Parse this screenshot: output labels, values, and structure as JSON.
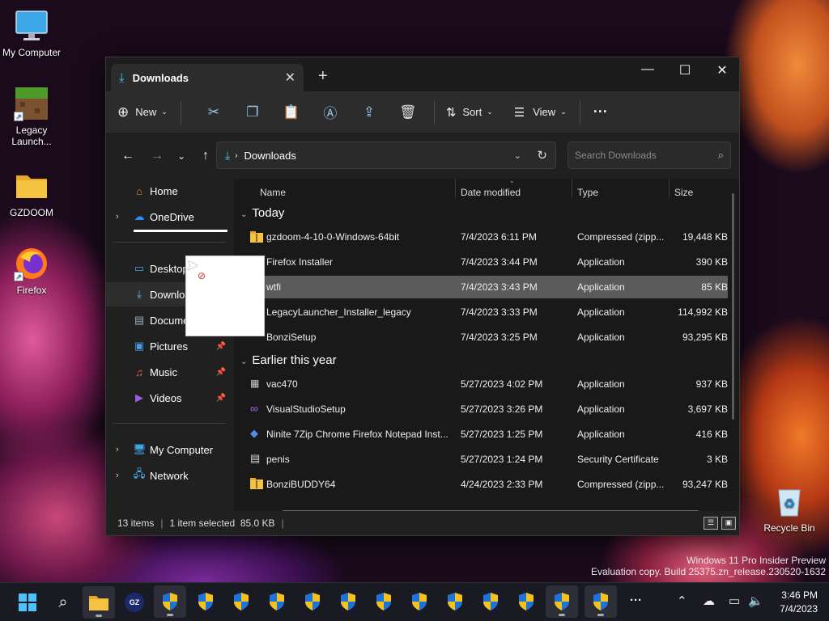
{
  "desktop": {
    "icons": [
      {
        "label": "My Computer",
        "icon": "monitor-icon"
      },
      {
        "label": "Legacy Launch...",
        "icon": "minecraft-icon"
      },
      {
        "label": "GZDOOM",
        "icon": "folder-icon"
      },
      {
        "label": "Firefox",
        "icon": "firefox-icon"
      },
      {
        "label": "Recycle Bin",
        "icon": "recycle-bin-icon"
      }
    ]
  },
  "window": {
    "tab_title": "Downloads",
    "toolbar": {
      "new_label": "New",
      "sort_label": "Sort",
      "view_label": "View"
    },
    "address": {
      "path": "Downloads",
      "search_placeholder": "Search Downloads"
    },
    "sidebar": {
      "items": [
        {
          "label": "Home",
          "icon": "home-icon"
        },
        {
          "label": "OneDrive",
          "icon": "cloud-icon"
        },
        {
          "label": "Desktop",
          "icon": "desktop-icon"
        },
        {
          "label": "Downloads",
          "icon": "download-icon"
        },
        {
          "label": "Documents",
          "icon": "document-icon"
        },
        {
          "label": "Pictures",
          "icon": "pictures-icon"
        },
        {
          "label": "Music",
          "icon": "music-icon"
        },
        {
          "label": "Videos",
          "icon": "videos-icon"
        },
        {
          "label": "My Computer",
          "icon": "computer-icon"
        },
        {
          "label": "Network",
          "icon": "network-icon"
        }
      ]
    },
    "columns": {
      "name": "Name",
      "date": "Date modified",
      "type": "Type",
      "size": "Size"
    },
    "groups": {
      "today": "Today",
      "earlier": "Earlier this year"
    },
    "files": [
      {
        "name": "gzdoom-4-10-0-Windows-64bit",
        "date": "7/4/2023 6:11 PM",
        "type": "Compressed (zipp...",
        "size": "19,448 KB",
        "icon": "zip-folder-icon"
      },
      {
        "name": "Firefox Installer",
        "date": "7/4/2023 3:44 PM",
        "type": "Application",
        "size": "390 KB",
        "icon": "app-icon"
      },
      {
        "name": "wtfi",
        "date": "7/4/2023 3:43 PM",
        "type": "Application",
        "size": "85 KB",
        "icon": "app-icon"
      },
      {
        "name": "LegacyLauncher_Installer_legacy",
        "date": "7/4/2023 3:33 PM",
        "type": "Application",
        "size": "114,992 KB",
        "icon": "app-icon"
      },
      {
        "name": "BonziSetup",
        "date": "7/4/2023 3:25 PM",
        "type": "Application",
        "size": "93,295 KB",
        "icon": "app-icon"
      },
      {
        "name": "vac470",
        "date": "5/27/2023 4:02 PM",
        "type": "Application",
        "size": "937 KB",
        "icon": "installer-icon"
      },
      {
        "name": "VisualStudioSetup",
        "date": "5/27/2023 3:26 PM",
        "type": "Application",
        "size": "3,697 KB",
        "icon": "visual-studio-icon"
      },
      {
        "name": "Ninite 7Zip Chrome Firefox Notepad Inst...",
        "date": "5/27/2023 1:25 PM",
        "type": "Application",
        "size": "416 KB",
        "icon": "ninite-icon"
      },
      {
        "name": "penis",
        "date": "5/27/2023 1:24 PM",
        "type": "Security Certificate",
        "size": "3 KB",
        "icon": "certificate-icon"
      },
      {
        "name": "BonziBUDDY64",
        "date": "4/24/2023 2:33 PM",
        "type": "Compressed (zipp...",
        "size": "93,247 KB",
        "icon": "zip-folder-icon"
      }
    ],
    "status": {
      "count": "13 items",
      "selected": "1 item selected  85.0 KB"
    }
  },
  "watermark": {
    "line1": "Windows 11 Pro Insider Preview",
    "line2": "Evaluation copy. Build 25375.zn_release.230520-1632"
  },
  "taskbar": {
    "time": "3:46 PM",
    "date": "7/4/2023"
  },
  "colors": {
    "accent": "#4cc2ff",
    "folder": "#f5c342",
    "shield_blue": "#1e73d8",
    "shield_yellow": "#f4c21a"
  }
}
